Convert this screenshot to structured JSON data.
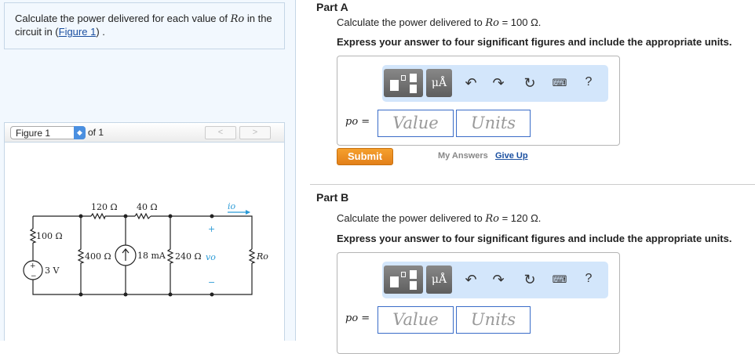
{
  "problem": {
    "text_before": "Calculate the power delivered for each value of ",
    "var": "Ro",
    "text_mid": " in the circuit in (",
    "link": "Figure 1",
    "text_after": ") ."
  },
  "figure": {
    "select": "Figure 1",
    "of": "of 1",
    "prev": "<",
    "next": ">"
  },
  "circuit": {
    "r1": "120 Ω",
    "r2": "40 Ω",
    "r3": "100 Ω",
    "r4": "400 Ω",
    "r5": "240 Ω",
    "ro": "Ro",
    "vs": "3 V",
    "is": "18 mA",
    "vo": "vo",
    "io": "io",
    "plus": "+",
    "minus": "−"
  },
  "partA": {
    "title": "Part A",
    "q_before": "Calculate the power delivered to ",
    "var": "Ro",
    "q_after": " = 100 Ω.",
    "instr": "Express your answer to four significant figures and include the appropriate units.",
    "label": "po =",
    "value_ph": "Value",
    "units_ph": "Units",
    "submit": "Submit",
    "my_answers": "My Answers",
    "give_up": "Give Up"
  },
  "partB": {
    "title": "Part B",
    "q_before": "Calculate the power delivered to ",
    "var": "Ro",
    "q_after": " = 120 Ω.",
    "instr": "Express your answer to four significant figures and include the appropriate units.",
    "label": "po =",
    "value_ph": "Value",
    "units_ph": "Units"
  },
  "toolbar": {
    "units": "μÅ",
    "help": "?"
  }
}
